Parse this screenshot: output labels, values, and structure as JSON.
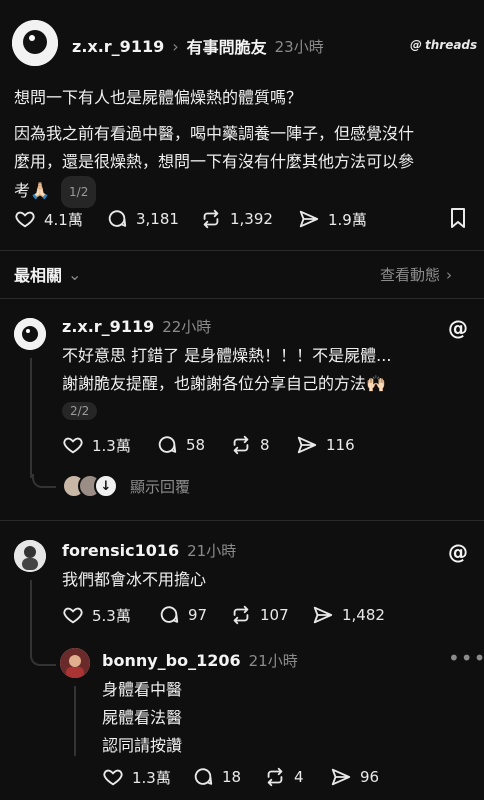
{
  "post": {
    "username": "z.x.r_9119",
    "community": "有事問脆友",
    "time": "23小時",
    "app_brand": "threads",
    "title": "想問一下有人也是屍體偏燥熱的體質嗎？",
    "body_lines": [
      "因為我之前有看過中醫，喝中藥調養一陣子，但感覺沒什",
      "麼用，還是很燥熱，想問一下有沒有什麼其他方法可以參",
      "考🙏🏻"
    ],
    "page_indicator": "1/2",
    "likes": "4.1萬",
    "comments": "3,181",
    "reposts": "1,392",
    "shares": "1.9萬"
  },
  "sort": {
    "label": "最相關",
    "view_activity": "查看動態"
  },
  "replies": [
    {
      "username": "z.x.r_9119",
      "time": "22小時",
      "lines": [
        "不好意思 打錯了 是身體燥熱！！！不是屍體...",
        "謝謝脆友提醒，也謝謝各位分享自己的方法🙌🏻"
      ],
      "page_indicator": "2/2",
      "likes": "1.3萬",
      "comments": "58",
      "reposts": "8",
      "shares": "116",
      "show_replies": "顯示回覆"
    },
    {
      "username": "forensic1016",
      "time": "21小時",
      "lines": [
        "我們都會冰不用擔心"
      ],
      "likes": "5.3萬",
      "comments": "97",
      "reposts": "107",
      "shares": "1,482"
    },
    {
      "username": "bonny_bo_1206",
      "time": "21小時",
      "lines": [
        "身體看中醫",
        "屍體看法醫",
        "認同請按讚"
      ],
      "likes": "1.3萬",
      "comments": "18",
      "reposts": "4",
      "shares": "96"
    }
  ],
  "colors": {
    "background": "#0f0f0f",
    "text": "#f3f3f3",
    "muted": "#8b8b8b"
  }
}
